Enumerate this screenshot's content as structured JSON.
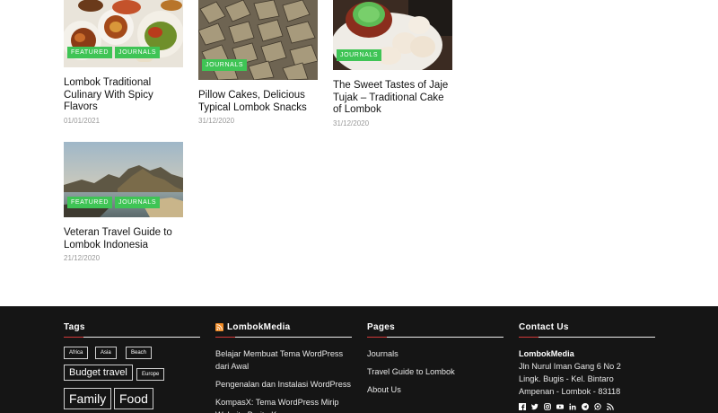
{
  "posts": [
    {
      "title": "Lombok Traditional Culinary With Spicy Flavors",
      "date": "01/01/2021",
      "tags": [
        "FEATURED",
        "JOURNALS"
      ]
    },
    {
      "title": "Pillow Cakes, Delicious Typical Lombok Snacks",
      "date": "31/12/2020",
      "tags": [
        "JOURNALS"
      ]
    },
    {
      "title": "The Sweet Tastes of Jaje Tujak – Traditional Cake of Lombok",
      "date": "31/12/2020",
      "tags": [
        "JOURNALS"
      ]
    },
    {
      "title": "Veteran Travel Guide to Lombok Indonesia",
      "date": "21/12/2020",
      "tags": [
        "FEATURED",
        "JOURNALS"
      ]
    }
  ],
  "footer": {
    "tags_title": "Tags",
    "tag_cloud": [
      "Africa",
      "Asia",
      "Beach",
      "Budget travel",
      "Europe",
      "Family",
      "Food"
    ],
    "feed_title": "LombokMedia",
    "feed_links": [
      "Belajar Membuat Tema WordPress dari Awal",
      "Pengenalan dan Instalasi WordPress",
      "KompasX: Tema WordPress Mirip Website Berita Kompas"
    ],
    "pages_title": "Pages",
    "pages_links": [
      "Journals",
      "Travel Guide to Lombok",
      "About Us"
    ],
    "contact_title": "Contact Us",
    "contact_name": "LombokMedia",
    "contact_address": [
      "Jln Nurul Iman Gang 6 No 2",
      "Lingk. Bugis - Kel. Bintaro",
      "Ampenan - Lombok - 83118"
    ],
    "social_icons": [
      "facebook-icon",
      "twitter-icon",
      "instagram-icon",
      "youtube-icon",
      "linkedin-icon",
      "telegram-icon",
      "whatsapp-icon",
      "rss-icon"
    ]
  },
  "colors": {
    "tag_green": "#3fc455",
    "footer_bg": "#151515",
    "accent_red": "#d23a3a",
    "rss_orange": "#f08a24"
  }
}
